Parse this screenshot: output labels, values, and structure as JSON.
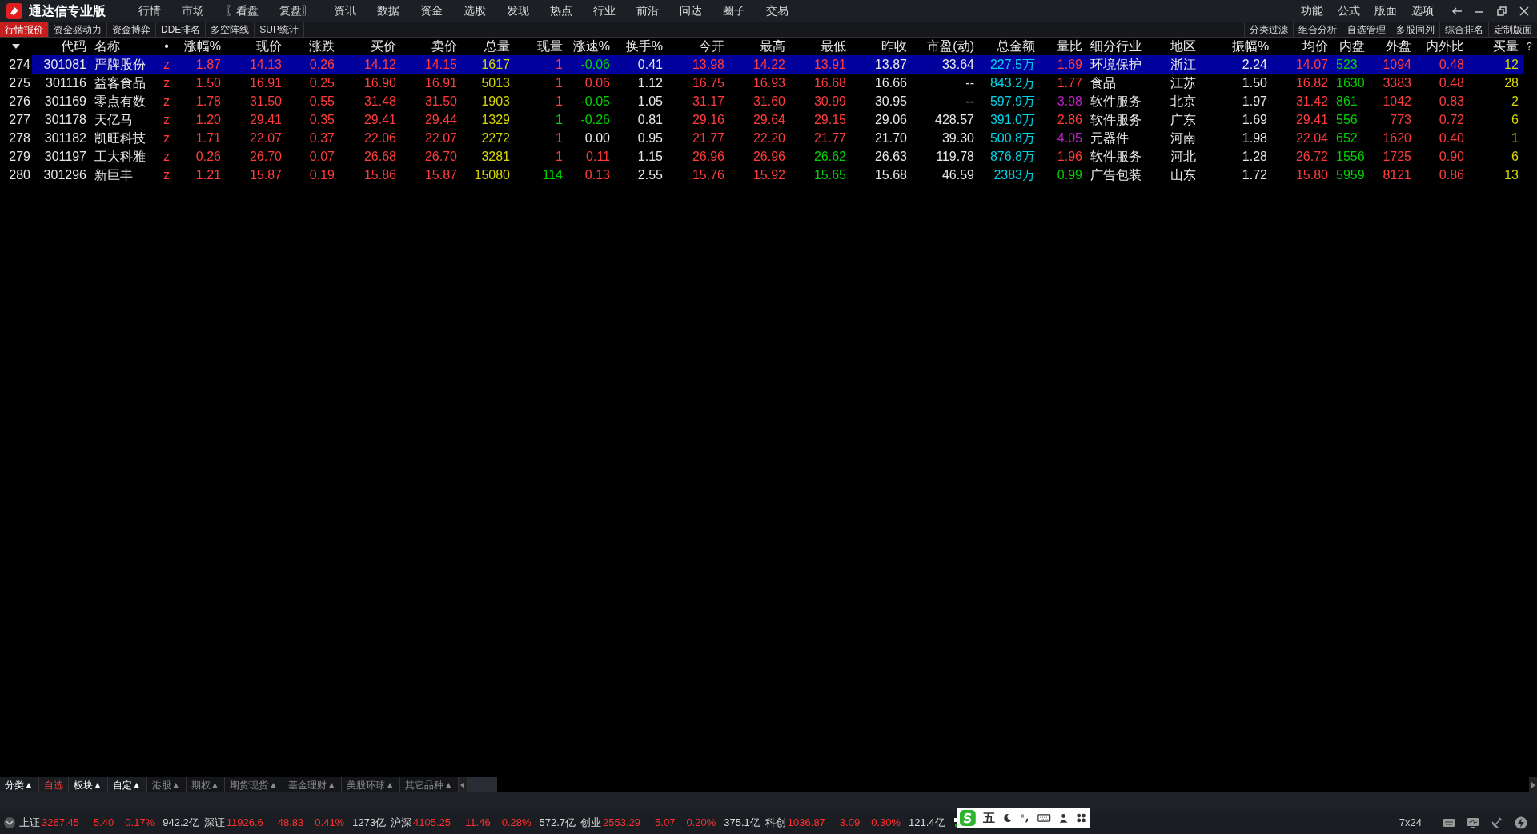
{
  "app": {
    "title": "通达信专业版"
  },
  "menu": [
    "行情",
    "市场",
    "〖看盘",
    "复盘〗",
    "资讯",
    "数据",
    "资金",
    "选股",
    "发现",
    "热点",
    "行业",
    "前沿",
    "问达",
    "圈子",
    "交易"
  ],
  "menu_right": [
    "功能",
    "公式",
    "版面",
    "选项"
  ],
  "view_tabs": [
    {
      "label": "行情报价",
      "selected": true
    },
    {
      "label": "资金驱动力",
      "selected": false
    },
    {
      "label": "资金博弈",
      "selected": false
    },
    {
      "label": "DDE排名",
      "selected": false
    },
    {
      "label": "多空阵线",
      "selected": false
    },
    {
      "label": "SUP统计",
      "selected": false
    }
  ],
  "tools": [
    "分类过滤",
    "组合分析",
    "自选管理",
    "多股同列",
    "综合排名",
    "定制版面"
  ],
  "table": {
    "columns": [
      "代码",
      "名称",
      "•",
      "涨幅%",
      "现价",
      "涨跌",
      "买价",
      "卖价",
      "总量",
      "现量",
      "涨速%",
      "换手%",
      "今开",
      "最高",
      "最低",
      "昨收",
      "市盈(动)",
      "总金额",
      "量比",
      "细分行业",
      "地区",
      "振幅%",
      "均价",
      "内盘",
      "外盘",
      "内外比",
      "买量"
    ],
    "help": "?",
    "rows": [
      {
        "index": "274",
        "selected": true,
        "cells": [
          {
            "text": "301081",
            "color": "#e8e8e8"
          },
          {
            "text": "严牌股份",
            "color": "#e8e8e8"
          },
          {
            "text": "z",
            "color": "#ff3c3c"
          },
          {
            "text": "1.87",
            "color": "#ff3c3c"
          },
          {
            "text": "14.13",
            "color": "#ff3c3c"
          },
          {
            "text": "0.26",
            "color": "#ff3c3c"
          },
          {
            "text": "14.12",
            "color": "#ff3c3c"
          },
          {
            "text": "14.15",
            "color": "#ff3c3c"
          },
          {
            "text": "1617",
            "color": "#d6d600"
          },
          {
            "text": "1",
            "color": "#ff3c3c"
          },
          {
            "text": "-0.06",
            "color": "#00d200"
          },
          {
            "text": "0.41",
            "color": "#e8e8e8"
          },
          {
            "text": "13.98",
            "color": "#ff3c3c"
          },
          {
            "text": "14.22",
            "color": "#ff3c3c"
          },
          {
            "text": "13.91",
            "color": "#ff3c3c"
          },
          {
            "text": "13.87",
            "color": "#e8e8e8"
          },
          {
            "text": "33.64",
            "color": "#e8e8e8"
          },
          {
            "text": "227.5万",
            "color": "#00d2e6"
          },
          {
            "text": "1.69",
            "color": "#ff3c3c"
          },
          {
            "text": "环境保护",
            "color": "#e8e8e8"
          },
          {
            "text": "浙江",
            "color": "#e8e8e8"
          },
          {
            "text": "2.24",
            "color": "#e8e8e8"
          },
          {
            "text": "14.07",
            "color": "#ff3c3c"
          },
          {
            "text": "523",
            "color": "#00d200"
          },
          {
            "text": "1094",
            "color": "#ff3c3c"
          },
          {
            "text": "0.48",
            "color": "#ff3c3c"
          },
          {
            "text": "12",
            "color": "#d6d600"
          }
        ]
      },
      {
        "index": "275",
        "selected": false,
        "cells": [
          {
            "text": "301116",
            "color": "#e8e8e8"
          },
          {
            "text": "益客食品",
            "color": "#e8e8e8"
          },
          {
            "text": "z",
            "color": "#ff3c3c"
          },
          {
            "text": "1.50",
            "color": "#ff3c3c"
          },
          {
            "text": "16.91",
            "color": "#ff3c3c"
          },
          {
            "text": "0.25",
            "color": "#ff3c3c"
          },
          {
            "text": "16.90",
            "color": "#ff3c3c"
          },
          {
            "text": "16.91",
            "color": "#ff3c3c"
          },
          {
            "text": "5013",
            "color": "#d6d600"
          },
          {
            "text": "1",
            "color": "#ff3c3c"
          },
          {
            "text": "0.06",
            "color": "#ff3c3c"
          },
          {
            "text": "1.12",
            "color": "#e8e8e8"
          },
          {
            "text": "16.75",
            "color": "#ff3c3c"
          },
          {
            "text": "16.93",
            "color": "#ff3c3c"
          },
          {
            "text": "16.68",
            "color": "#ff3c3c"
          },
          {
            "text": "16.66",
            "color": "#e8e8e8"
          },
          {
            "text": "--",
            "color": "#e8e8e8"
          },
          {
            "text": "843.2万",
            "color": "#00d2e6"
          },
          {
            "text": "1.77",
            "color": "#ff3c3c"
          },
          {
            "text": "食品",
            "color": "#e8e8e8"
          },
          {
            "text": "江苏",
            "color": "#e8e8e8"
          },
          {
            "text": "1.50",
            "color": "#e8e8e8"
          },
          {
            "text": "16.82",
            "color": "#ff3c3c"
          },
          {
            "text": "1630",
            "color": "#00d200"
          },
          {
            "text": "3383",
            "color": "#ff3c3c"
          },
          {
            "text": "0.48",
            "color": "#ff3c3c"
          },
          {
            "text": "28",
            "color": "#d6d600"
          }
        ]
      },
      {
        "index": "276",
        "selected": false,
        "cells": [
          {
            "text": "301169",
            "color": "#e8e8e8"
          },
          {
            "text": "零点有数",
            "color": "#e8e8e8"
          },
          {
            "text": "z",
            "color": "#ff3c3c"
          },
          {
            "text": "1.78",
            "color": "#ff3c3c"
          },
          {
            "text": "31.50",
            "color": "#ff3c3c"
          },
          {
            "text": "0.55",
            "color": "#ff3c3c"
          },
          {
            "text": "31.48",
            "color": "#ff3c3c"
          },
          {
            "text": "31.50",
            "color": "#ff3c3c"
          },
          {
            "text": "1903",
            "color": "#d6d600"
          },
          {
            "text": "1",
            "color": "#ff3c3c"
          },
          {
            "text": "-0.05",
            "color": "#00d200"
          },
          {
            "text": "1.05",
            "color": "#e8e8e8"
          },
          {
            "text": "31.17",
            "color": "#ff3c3c"
          },
          {
            "text": "31.60",
            "color": "#ff3c3c"
          },
          {
            "text": "30.99",
            "color": "#ff3c3c"
          },
          {
            "text": "30.95",
            "color": "#e8e8e8"
          },
          {
            "text": "--",
            "color": "#e8e8e8"
          },
          {
            "text": "597.9万",
            "color": "#00d2e6"
          },
          {
            "text": "3.98",
            "color": "#c020c8"
          },
          {
            "text": "软件服务",
            "color": "#e8e8e8"
          },
          {
            "text": "北京",
            "color": "#e8e8e8"
          },
          {
            "text": "1.97",
            "color": "#e8e8e8"
          },
          {
            "text": "31.42",
            "color": "#ff3c3c"
          },
          {
            "text": "861",
            "color": "#00d200"
          },
          {
            "text": "1042",
            "color": "#ff3c3c"
          },
          {
            "text": "0.83",
            "color": "#ff3c3c"
          },
          {
            "text": "2",
            "color": "#d6d600"
          }
        ]
      },
      {
        "index": "277",
        "selected": false,
        "cells": [
          {
            "text": "301178",
            "color": "#e8e8e8"
          },
          {
            "text": "天亿马",
            "color": "#e8e8e8"
          },
          {
            "text": "z",
            "color": "#ff3c3c"
          },
          {
            "text": "1.20",
            "color": "#ff3c3c"
          },
          {
            "text": "29.41",
            "color": "#ff3c3c"
          },
          {
            "text": "0.35",
            "color": "#ff3c3c"
          },
          {
            "text": "29.41",
            "color": "#ff3c3c"
          },
          {
            "text": "29.44",
            "color": "#ff3c3c"
          },
          {
            "text": "1329",
            "color": "#d6d600"
          },
          {
            "text": "1",
            "color": "#00d200"
          },
          {
            "text": "-0.26",
            "color": "#00d200"
          },
          {
            "text": "0.81",
            "color": "#e8e8e8"
          },
          {
            "text": "29.16",
            "color": "#ff3c3c"
          },
          {
            "text": "29.64",
            "color": "#ff3c3c"
          },
          {
            "text": "29.15",
            "color": "#ff3c3c"
          },
          {
            "text": "29.06",
            "color": "#e8e8e8"
          },
          {
            "text": "428.57",
            "color": "#e8e8e8"
          },
          {
            "text": "391.0万",
            "color": "#00d2e6"
          },
          {
            "text": "2.86",
            "color": "#ff3c3c"
          },
          {
            "text": "软件服务",
            "color": "#e8e8e8"
          },
          {
            "text": "广东",
            "color": "#e8e8e8"
          },
          {
            "text": "1.69",
            "color": "#e8e8e8"
          },
          {
            "text": "29.41",
            "color": "#ff3c3c"
          },
          {
            "text": "556",
            "color": "#00d200"
          },
          {
            "text": "773",
            "color": "#ff3c3c"
          },
          {
            "text": "0.72",
            "color": "#ff3c3c"
          },
          {
            "text": "6",
            "color": "#d6d600"
          }
        ]
      },
      {
        "index": "278",
        "selected": false,
        "cells": [
          {
            "text": "301182",
            "color": "#e8e8e8"
          },
          {
            "text": "凯旺科技",
            "color": "#e8e8e8"
          },
          {
            "text": "z",
            "color": "#ff3c3c"
          },
          {
            "text": "1.71",
            "color": "#ff3c3c"
          },
          {
            "text": "22.07",
            "color": "#ff3c3c"
          },
          {
            "text": "0.37",
            "color": "#ff3c3c"
          },
          {
            "text": "22.06",
            "color": "#ff3c3c"
          },
          {
            "text": "22.07",
            "color": "#ff3c3c"
          },
          {
            "text": "2272",
            "color": "#d6d600"
          },
          {
            "text": "1",
            "color": "#ff3c3c"
          },
          {
            "text": "0.00",
            "color": "#e8e8e8"
          },
          {
            "text": "0.95",
            "color": "#e8e8e8"
          },
          {
            "text": "21.77",
            "color": "#ff3c3c"
          },
          {
            "text": "22.20",
            "color": "#ff3c3c"
          },
          {
            "text": "21.77",
            "color": "#ff3c3c"
          },
          {
            "text": "21.70",
            "color": "#e8e8e8"
          },
          {
            "text": "39.30",
            "color": "#e8e8e8"
          },
          {
            "text": "500.8万",
            "color": "#00d2e6"
          },
          {
            "text": "4.05",
            "color": "#c020c8"
          },
          {
            "text": "元器件",
            "color": "#e8e8e8"
          },
          {
            "text": "河南",
            "color": "#e8e8e8"
          },
          {
            "text": "1.98",
            "color": "#e8e8e8"
          },
          {
            "text": "22.04",
            "color": "#ff3c3c"
          },
          {
            "text": "652",
            "color": "#00d200"
          },
          {
            "text": "1620",
            "color": "#ff3c3c"
          },
          {
            "text": "0.40",
            "color": "#ff3c3c"
          },
          {
            "text": "1",
            "color": "#d6d600"
          }
        ]
      },
      {
        "index": "279",
        "selected": false,
        "cells": [
          {
            "text": "301197",
            "color": "#e8e8e8"
          },
          {
            "text": "工大科雅",
            "color": "#e8e8e8"
          },
          {
            "text": "z",
            "color": "#ff3c3c"
          },
          {
            "text": "0.26",
            "color": "#ff3c3c"
          },
          {
            "text": "26.70",
            "color": "#ff3c3c"
          },
          {
            "text": "0.07",
            "color": "#ff3c3c"
          },
          {
            "text": "26.68",
            "color": "#ff3c3c"
          },
          {
            "text": "26.70",
            "color": "#ff3c3c"
          },
          {
            "text": "3281",
            "color": "#d6d600"
          },
          {
            "text": "1",
            "color": "#ff3c3c"
          },
          {
            "text": "0.11",
            "color": "#ff3c3c"
          },
          {
            "text": "1.15",
            "color": "#e8e8e8"
          },
          {
            "text": "26.96",
            "color": "#ff3c3c"
          },
          {
            "text": "26.96",
            "color": "#ff3c3c"
          },
          {
            "text": "26.62",
            "color": "#00d200"
          },
          {
            "text": "26.63",
            "color": "#e8e8e8"
          },
          {
            "text": "119.78",
            "color": "#e8e8e8"
          },
          {
            "text": "876.8万",
            "color": "#00d2e6"
          },
          {
            "text": "1.96",
            "color": "#ff3c3c"
          },
          {
            "text": "软件服务",
            "color": "#e8e8e8"
          },
          {
            "text": "河北",
            "color": "#e8e8e8"
          },
          {
            "text": "1.28",
            "color": "#e8e8e8"
          },
          {
            "text": "26.72",
            "color": "#ff3c3c"
          },
          {
            "text": "1556",
            "color": "#00d200"
          },
          {
            "text": "1725",
            "color": "#ff3c3c"
          },
          {
            "text": "0.90",
            "color": "#ff3c3c"
          },
          {
            "text": "6",
            "color": "#d6d600"
          }
        ]
      },
      {
        "index": "280",
        "selected": false,
        "cells": [
          {
            "text": "301296",
            "color": "#e8e8e8"
          },
          {
            "text": "新巨丰",
            "color": "#e8e8e8"
          },
          {
            "text": "z",
            "color": "#ff3c3c"
          },
          {
            "text": "1.21",
            "color": "#ff3c3c"
          },
          {
            "text": "15.87",
            "color": "#ff3c3c"
          },
          {
            "text": "0.19",
            "color": "#ff3c3c"
          },
          {
            "text": "15.86",
            "color": "#ff3c3c"
          },
          {
            "text": "15.87",
            "color": "#ff3c3c"
          },
          {
            "text": "15080",
            "color": "#d6d600"
          },
          {
            "text": "114",
            "color": "#00d200"
          },
          {
            "text": "0.13",
            "color": "#ff3c3c"
          },
          {
            "text": "2.55",
            "color": "#e8e8e8"
          },
          {
            "text": "15.76",
            "color": "#ff3c3c"
          },
          {
            "text": "15.92",
            "color": "#ff3c3c"
          },
          {
            "text": "15.65",
            "color": "#00d200"
          },
          {
            "text": "15.68",
            "color": "#e8e8e8"
          },
          {
            "text": "46.59",
            "color": "#e8e8e8"
          },
          {
            "text": "2383万",
            "color": "#00d2e6"
          },
          {
            "text": "0.99",
            "color": "#00d200"
          },
          {
            "text": "广告包装",
            "color": "#e8e8e8"
          },
          {
            "text": "山东",
            "color": "#e8e8e8"
          },
          {
            "text": "1.72",
            "color": "#e8e8e8"
          },
          {
            "text": "15.80",
            "color": "#ff3c3c"
          },
          {
            "text": "5959",
            "color": "#00d200"
          },
          {
            "text": "8121",
            "color": "#ff3c3c"
          },
          {
            "text": "0.86",
            "color": "#ff3c3c"
          },
          {
            "text": "13",
            "color": "#d6d600"
          }
        ]
      }
    ]
  },
  "category_tabs": [
    {
      "label": "分类▲",
      "selected": false,
      "disabled": false
    },
    {
      "label": "自选",
      "selected": true,
      "disabled": false
    },
    {
      "label": "板块▲",
      "selected": false,
      "disabled": false
    },
    {
      "label": "自定▲",
      "selected": false,
      "disabled": false
    },
    {
      "label": "港股▲",
      "selected": false,
      "disabled": true
    },
    {
      "label": "期权▲",
      "selected": false,
      "disabled": true
    },
    {
      "label": "期货现货▲",
      "selected": false,
      "disabled": true
    },
    {
      "label": "基金理财▲",
      "selected": false,
      "disabled": true
    },
    {
      "label": "美股环球▲",
      "selected": false,
      "disabled": true
    },
    {
      "label": "其它品种▲",
      "selected": false,
      "disabled": true
    }
  ],
  "indices": [
    {
      "name": "上证",
      "value": "3267.45",
      "change": "5.40",
      "percent": "0.17%",
      "amount": "942.2亿"
    },
    {
      "name": "深证",
      "value": "11926.6",
      "change": "48.83",
      "percent": "0.41%",
      "amount": "1273亿"
    },
    {
      "name": "沪深",
      "value": "4105.25",
      "change": "11.46",
      "percent": "0.28%",
      "amount": "572.7亿"
    },
    {
      "name": "创业",
      "value": "2553.29",
      "change": "5.07",
      "percent": "0.20%",
      "amount": "375.1亿"
    },
    {
      "name": "科创",
      "value": "1036.87",
      "change": "3.09",
      "percent": "0.30%",
      "amount": "121.4亿"
    }
  ],
  "ime": {
    "mode": "五"
  },
  "status_right": "7x24"
}
